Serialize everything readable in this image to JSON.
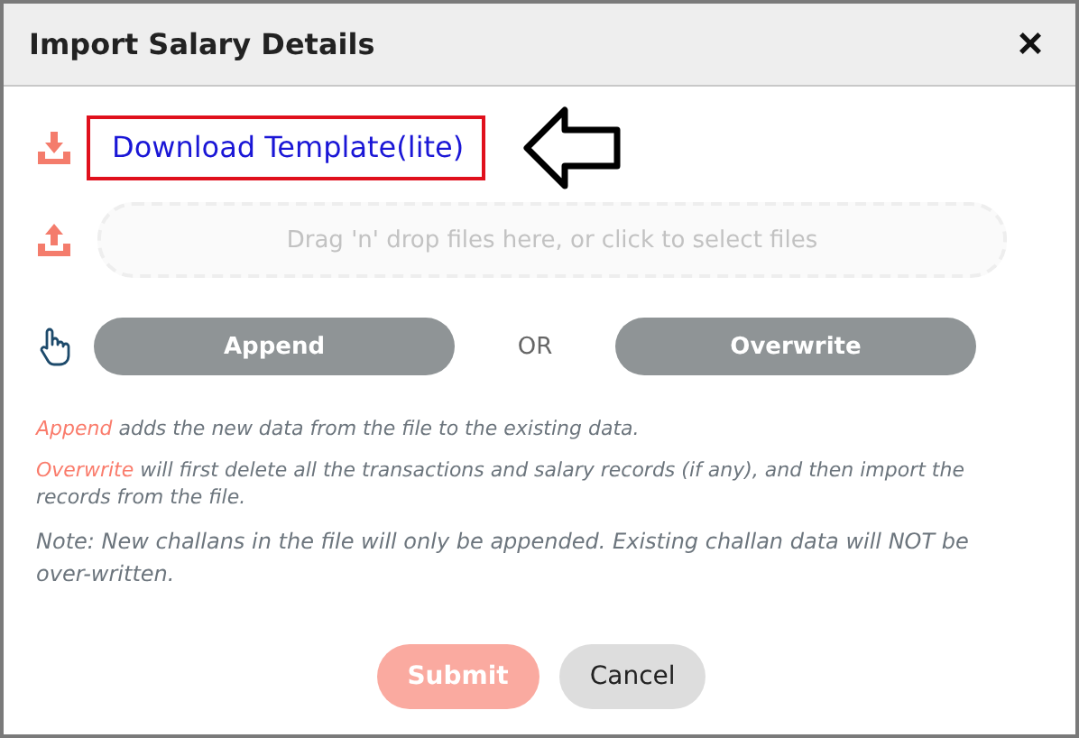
{
  "dialog": {
    "title": "Import Salary Details",
    "close": "×"
  },
  "download_link": {
    "label": "Download Template(lite)"
  },
  "dropzone": {
    "placeholder": "Drag 'n' drop files here, or click to select files"
  },
  "mode_buttons": [
    {
      "label": "Append",
      "selected": false
    },
    {
      "label": "Overwrite",
      "selected": false
    }
  ],
  "separator": "OR",
  "explanations": [
    {
      "term": "Append",
      "text": "adds the new data from the file to the existing data."
    },
    {
      "term": "Overwrite",
      "text": "will first delete all the transactions and salary records (if any), and then import the records from the file."
    }
  ],
  "note": "Note: New challans in the file will only be appended. Existing challan data will NOT be over-written.",
  "actions": [
    {
      "label": "Submit",
      "kind": "primary",
      "disabled": true
    },
    {
      "label": "Cancel",
      "kind": "secondary",
      "disabled": false
    }
  ]
}
